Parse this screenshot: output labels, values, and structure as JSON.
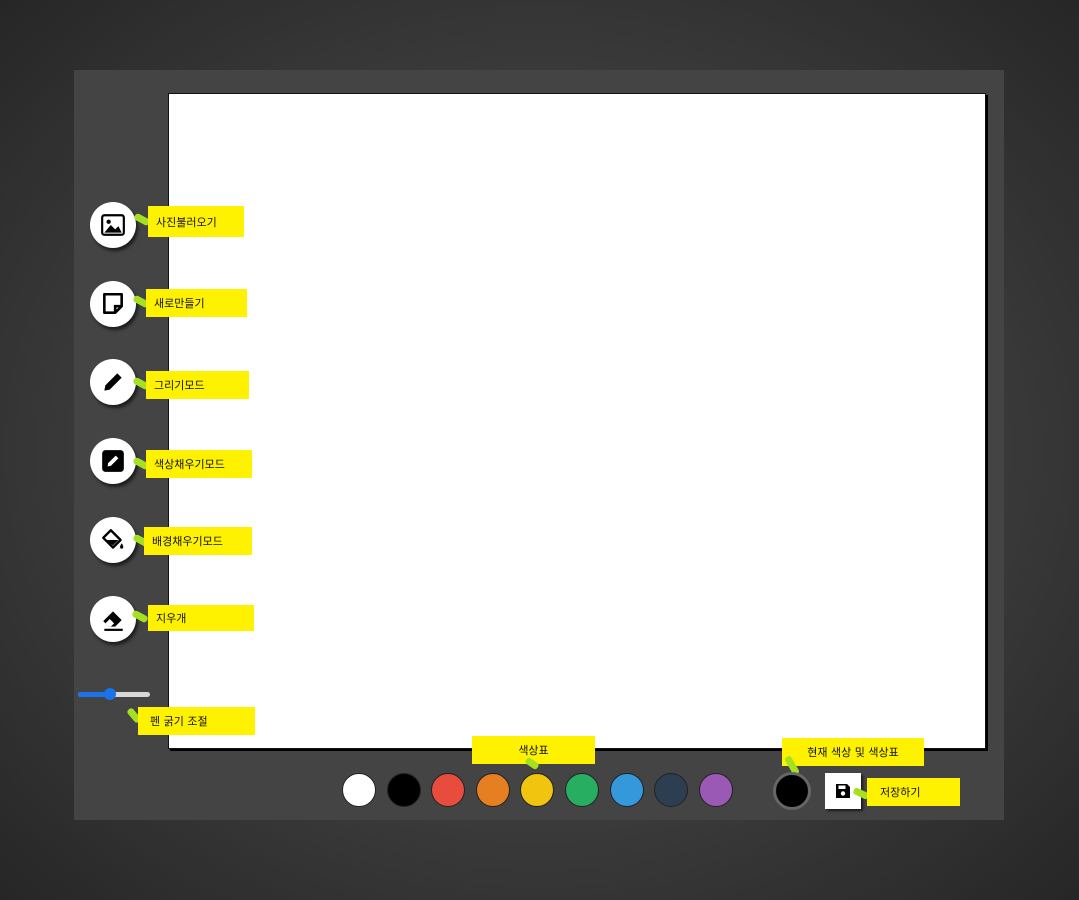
{
  "tools": [
    {
      "id": "load-photo",
      "icon": "image-icon",
      "label": "사진불러오기"
    },
    {
      "id": "new",
      "icon": "sticky-note-icon",
      "label": "새로만들기"
    },
    {
      "id": "draw-mode",
      "icon": "pencil-icon",
      "label": "그리기모드"
    },
    {
      "id": "fill-mode",
      "icon": "pen-square-icon",
      "label": "색상채우기모드"
    },
    {
      "id": "bg-fill-mode",
      "icon": "paint-bucket-icon",
      "label": "배경채우기모드"
    },
    {
      "id": "eraser",
      "icon": "eraser-icon",
      "label": "지우개"
    }
  ],
  "pen_width": {
    "label": "펜 굵기 조절",
    "value_fraction": 0.45
  },
  "palette": {
    "label": "색상표",
    "colors": [
      "#ffffff",
      "#000000",
      "#e74c3c",
      "#e67e22",
      "#f1c40f",
      "#27ae60",
      "#3498db",
      "#2c3e50",
      "#9b59b6"
    ]
  },
  "current_color": {
    "label": "현재 색상 및 색상표",
    "value": "#000000"
  },
  "save": {
    "label": "저장하기",
    "icon": "save-icon"
  },
  "theme": {
    "note_color": "#fff200",
    "arrow_color": "#a6e022",
    "panel_color": "#444444"
  }
}
